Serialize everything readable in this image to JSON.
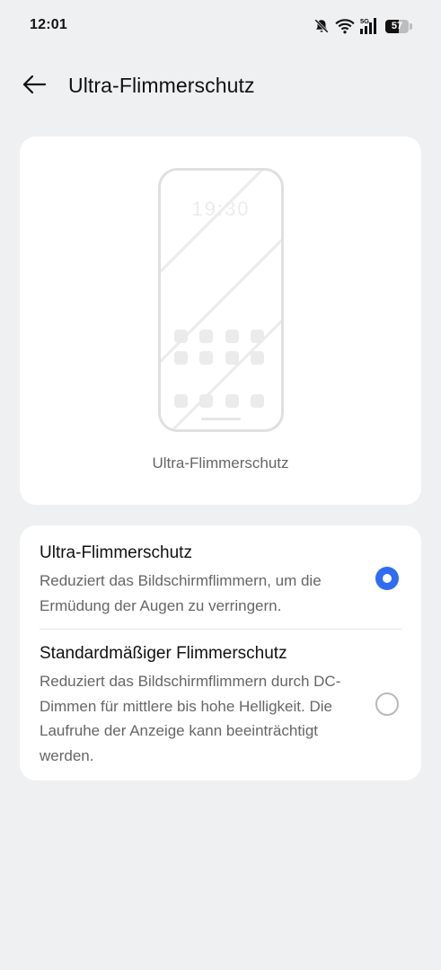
{
  "status_bar": {
    "time": "12:01",
    "network_label": "5G",
    "battery_percent": "57",
    "icons": [
      "bell-off-icon",
      "wifi-icon",
      "cellular-signal-icon",
      "battery-icon"
    ]
  },
  "header": {
    "back_icon": "arrow-left-icon",
    "title": "Ultra-Flimmerschutz"
  },
  "preview": {
    "clock_text": "19:30",
    "caption": "Ultra-Flimmerschutz"
  },
  "options": [
    {
      "title": "Ultra-Flimmerschutz",
      "description": "Reduziert das Bildschirmflimmern, um die Ermüdung der Augen zu verringern.",
      "selected": true
    },
    {
      "title": "Standardmäßiger Flimmerschutz",
      "description": "Reduziert das Bildschirmflimmern durch DC-Dimmen für mittlere bis hohe Helligkeit. Die Laufruhe der Anzeige kann beeinträchtigt werden.",
      "selected": false
    }
  ],
  "colors": {
    "background": "#eff0f2",
    "card": "#ffffff",
    "accent": "#2f6cf2",
    "secondary_text": "#666666"
  }
}
